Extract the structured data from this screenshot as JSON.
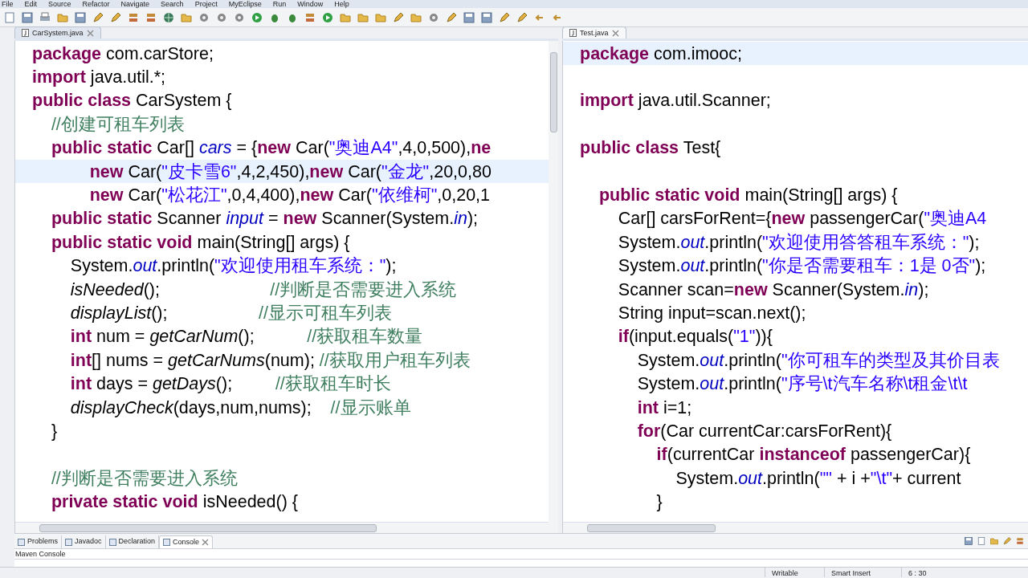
{
  "menu": [
    "File",
    "Edit",
    "Source",
    "Refactor",
    "Navigate",
    "Search",
    "Project",
    "MyEclipse",
    "Run",
    "Window",
    "Help"
  ],
  "editors": [
    {
      "tab": {
        "label": "CarSystem.java",
        "selected": true
      },
      "lines": [
        {
          "current": false,
          "tokens": [
            {
              "kind": "kw",
              "text": "package"
            },
            {
              "kind": "plain",
              "text": " com.carStore;"
            }
          ]
        },
        {
          "current": false,
          "tokens": [
            {
              "kind": "kw",
              "text": "import"
            },
            {
              "kind": "plain",
              "text": " java.util.*;"
            }
          ]
        },
        {
          "current": false,
          "tokens": [
            {
              "kind": "kw",
              "text": "public class"
            },
            {
              "kind": "plain",
              "text": " CarSystem {"
            }
          ]
        },
        {
          "current": false,
          "tokens": [
            {
              "kind": "comment",
              "text": "    //创建可租车列表"
            }
          ]
        },
        {
          "current": false,
          "tokens": [
            {
              "kind": "kw",
              "text": "    public static"
            },
            {
              "kind": "plain",
              "text": " Car[] "
            },
            {
              "kind": "field",
              "text": "cars"
            },
            {
              "kind": "plain",
              "text": " = {"
            },
            {
              "kind": "kw",
              "text": "new"
            },
            {
              "kind": "plain",
              "text": " Car("
            },
            {
              "kind": "str",
              "text": "\"奥迪A4\""
            },
            {
              "kind": "plain",
              "text": ",4,0,500),"
            },
            {
              "kind": "kw",
              "text": "ne"
            }
          ]
        },
        {
          "current": true,
          "tokens": [
            {
              "kind": "kw",
              "text": "            new"
            },
            {
              "kind": "plain",
              "text": " Car("
            },
            {
              "kind": "str",
              "text": "\"皮卡雪6\""
            },
            {
              "kind": "plain",
              "text": ",4,2,450),"
            },
            {
              "kind": "kw",
              "text": "new"
            },
            {
              "kind": "plain",
              "text": " Car("
            },
            {
              "kind": "str",
              "text": "\"金龙\""
            },
            {
              "kind": "plain",
              "text": ",20,0,80"
            }
          ]
        },
        {
          "current": false,
          "tokens": [
            {
              "kind": "kw",
              "text": "            new"
            },
            {
              "kind": "plain",
              "text": " Car("
            },
            {
              "kind": "str",
              "text": "\"松花江\""
            },
            {
              "kind": "plain",
              "text": ",0,4,400),"
            },
            {
              "kind": "kw",
              "text": "new"
            },
            {
              "kind": "plain",
              "text": " Car("
            },
            {
              "kind": "str",
              "text": "\"依维柯\""
            },
            {
              "kind": "plain",
              "text": ",0,20,1"
            }
          ]
        },
        {
          "current": false,
          "tokens": [
            {
              "kind": "kw",
              "text": "    public static"
            },
            {
              "kind": "plain",
              "text": " Scanner "
            },
            {
              "kind": "field",
              "text": "input"
            },
            {
              "kind": "plain",
              "text": " = "
            },
            {
              "kind": "kw",
              "text": "new"
            },
            {
              "kind": "plain",
              "text": " Scanner(System."
            },
            {
              "kind": "field",
              "text": "in"
            },
            {
              "kind": "plain",
              "text": ");"
            }
          ]
        },
        {
          "current": false,
          "tokens": [
            {
              "kind": "kw",
              "text": "    public static void"
            },
            {
              "kind": "plain",
              "text": " main(String[] args) {"
            }
          ]
        },
        {
          "current": false,
          "tokens": [
            {
              "kind": "plain",
              "text": "        System."
            },
            {
              "kind": "field",
              "text": "out"
            },
            {
              "kind": "plain",
              "text": ".println("
            },
            {
              "kind": "str",
              "text": "\"欢迎使用租车系统：\""
            },
            {
              "kind": "plain",
              "text": ");"
            }
          ]
        },
        {
          "current": false,
          "tokens": [
            {
              "kind": "method",
              "text": "        isNeeded"
            },
            {
              "kind": "plain",
              "text": "();                       "
            },
            {
              "kind": "comment",
              "text": "//判断是否需要进入系统"
            }
          ]
        },
        {
          "current": false,
          "tokens": [
            {
              "kind": "method",
              "text": "        displayList"
            },
            {
              "kind": "plain",
              "text": "();                   "
            },
            {
              "kind": "comment",
              "text": "//显示可租车列表"
            }
          ]
        },
        {
          "current": false,
          "tokens": [
            {
              "kind": "kw",
              "text": "        int"
            },
            {
              "kind": "plain",
              "text": " num = "
            },
            {
              "kind": "method",
              "text": "getCarNum"
            },
            {
              "kind": "plain",
              "text": "();           "
            },
            {
              "kind": "comment",
              "text": "//获取租车数量"
            }
          ]
        },
        {
          "current": false,
          "tokens": [
            {
              "kind": "kw",
              "text": "        int"
            },
            {
              "kind": "plain",
              "text": "[] nums = "
            },
            {
              "kind": "method",
              "text": "getCarNums"
            },
            {
              "kind": "plain",
              "text": "(num); "
            },
            {
              "kind": "comment",
              "text": "//获取用户租车列表"
            }
          ]
        },
        {
          "current": false,
          "tokens": [
            {
              "kind": "kw",
              "text": "        int"
            },
            {
              "kind": "plain",
              "text": " days = "
            },
            {
              "kind": "method",
              "text": "getDays"
            },
            {
              "kind": "plain",
              "text": "();         "
            },
            {
              "kind": "comment",
              "text": "//获取租车时长"
            }
          ]
        },
        {
          "current": false,
          "tokens": [
            {
              "kind": "method",
              "text": "        displayCheck"
            },
            {
              "kind": "plain",
              "text": "(days,num,nums);    "
            },
            {
              "kind": "comment",
              "text": "//显示账单"
            }
          ]
        },
        {
          "current": false,
          "tokens": [
            {
              "kind": "plain",
              "text": "    }"
            }
          ]
        },
        {
          "current": false
        },
        {
          "current": false,
          "tokens": [
            {
              "kind": "comment",
              "text": "    //判断是否需要进入系统"
            }
          ]
        },
        {
          "current": false,
          "tokens": [
            {
              "kind": "kw",
              "text": "    private static void"
            },
            {
              "kind": "plain",
              "text": " isNeeded() {"
            }
          ]
        }
      ]
    },
    {
      "tab": {
        "label": "Test.java",
        "selected": false
      },
      "lines": [
        {
          "current": true,
          "tokens": [
            {
              "kind": "kw",
              "text": "package"
            },
            {
              "kind": "plain",
              "text": " com.imooc;"
            }
          ]
        },
        {
          "current": false
        },
        {
          "current": false,
          "tokens": [
            {
              "kind": "kw",
              "text": "import"
            },
            {
              "kind": "plain",
              "text": " java.util.Scanner;"
            }
          ]
        },
        {
          "current": false
        },
        {
          "current": false,
          "tokens": [
            {
              "kind": "kw",
              "text": "public class"
            },
            {
              "kind": "plain",
              "text": " Test{"
            }
          ]
        },
        {
          "current": false
        },
        {
          "current": false,
          "tokens": [
            {
              "kind": "kw",
              "text": "    public static void"
            },
            {
              "kind": "plain",
              "text": " main(String[] args) {"
            }
          ]
        },
        {
          "current": false,
          "tokens": [
            {
              "kind": "plain",
              "text": "        Car[] carsForRent={"
            },
            {
              "kind": "kw",
              "text": "new"
            },
            {
              "kind": "plain",
              "text": " passengerCar("
            },
            {
              "kind": "str",
              "text": "\"奥迪A4"
            }
          ]
        },
        {
          "current": false,
          "tokens": [
            {
              "kind": "plain",
              "text": "        System."
            },
            {
              "kind": "field",
              "text": "out"
            },
            {
              "kind": "plain",
              "text": ".println("
            },
            {
              "kind": "str",
              "text": "\"欢迎使用答答租车系统：\""
            },
            {
              "kind": "plain",
              "text": ");"
            }
          ]
        },
        {
          "current": false,
          "tokens": [
            {
              "kind": "plain",
              "text": "        System."
            },
            {
              "kind": "field",
              "text": "out"
            },
            {
              "kind": "plain",
              "text": ".println("
            },
            {
              "kind": "str",
              "text": "\"你是否需要租车：1是 0否\""
            },
            {
              "kind": "plain",
              "text": ");"
            }
          ]
        },
        {
          "current": false,
          "tokens": [
            {
              "kind": "plain",
              "text": "        Scanner scan="
            },
            {
              "kind": "kw",
              "text": "new"
            },
            {
              "kind": "plain",
              "text": " Scanner(System."
            },
            {
              "kind": "field",
              "text": "in"
            },
            {
              "kind": "plain",
              "text": ");"
            }
          ]
        },
        {
          "current": false,
          "tokens": [
            {
              "kind": "plain",
              "text": "        String input=scan.next();"
            }
          ]
        },
        {
          "current": false,
          "tokens": [
            {
              "kind": "kw",
              "text": "        if"
            },
            {
              "kind": "plain",
              "text": "(input.equals("
            },
            {
              "kind": "str",
              "text": "\"1\""
            },
            {
              "kind": "plain",
              "text": ")){"
            }
          ]
        },
        {
          "current": false,
          "tokens": [
            {
              "kind": "plain",
              "text": "            System."
            },
            {
              "kind": "field",
              "text": "out"
            },
            {
              "kind": "plain",
              "text": ".println("
            },
            {
              "kind": "str",
              "text": "\"你可租车的类型及其价目表"
            }
          ]
        },
        {
          "current": false,
          "tokens": [
            {
              "kind": "plain",
              "text": "            System."
            },
            {
              "kind": "field",
              "text": "out"
            },
            {
              "kind": "plain",
              "text": ".println("
            },
            {
              "kind": "str",
              "text": "\"序号\\t汽车名称\\t租金\\t\\t"
            }
          ]
        },
        {
          "current": false,
          "tokens": [
            {
              "kind": "kw",
              "text": "            int"
            },
            {
              "kind": "plain",
              "text": " i=1;"
            }
          ]
        },
        {
          "current": false,
          "tokens": [
            {
              "kind": "kw",
              "text": "            for"
            },
            {
              "kind": "plain",
              "text": "(Car currentCar:carsForRent){"
            }
          ]
        },
        {
          "current": false,
          "tokens": [
            {
              "kind": "kw",
              "text": "                if"
            },
            {
              "kind": "plain",
              "text": "(currentCar "
            },
            {
              "kind": "kw",
              "text": "instanceof"
            },
            {
              "kind": "plain",
              "text": " passengerCar){"
            }
          ]
        },
        {
          "current": false,
          "tokens": [
            {
              "kind": "plain",
              "text": "                    System."
            },
            {
              "kind": "field",
              "text": "out"
            },
            {
              "kind": "plain",
              "text": ".println("
            },
            {
              "kind": "str",
              "text": "\"\""
            },
            {
              "kind": "plain",
              "text": " + i +"
            },
            {
              "kind": "str",
              "text": "\"\\t\""
            },
            {
              "kind": "plain",
              "text": "+ current"
            }
          ]
        },
        {
          "current": false,
          "tokens": [
            {
              "kind": "plain",
              "text": "                }"
            }
          ]
        }
      ]
    }
  ],
  "bottom_tabs": [
    {
      "label": "Problems",
      "selected": false
    },
    {
      "label": "Javadoc",
      "selected": false
    },
    {
      "label": "Declaration",
      "selected": false
    },
    {
      "label": "Console",
      "selected": true
    }
  ],
  "console_title": "Maven Console",
  "status_bar": [
    "Writable",
    "Smart Insert",
    "6 : 30"
  ]
}
